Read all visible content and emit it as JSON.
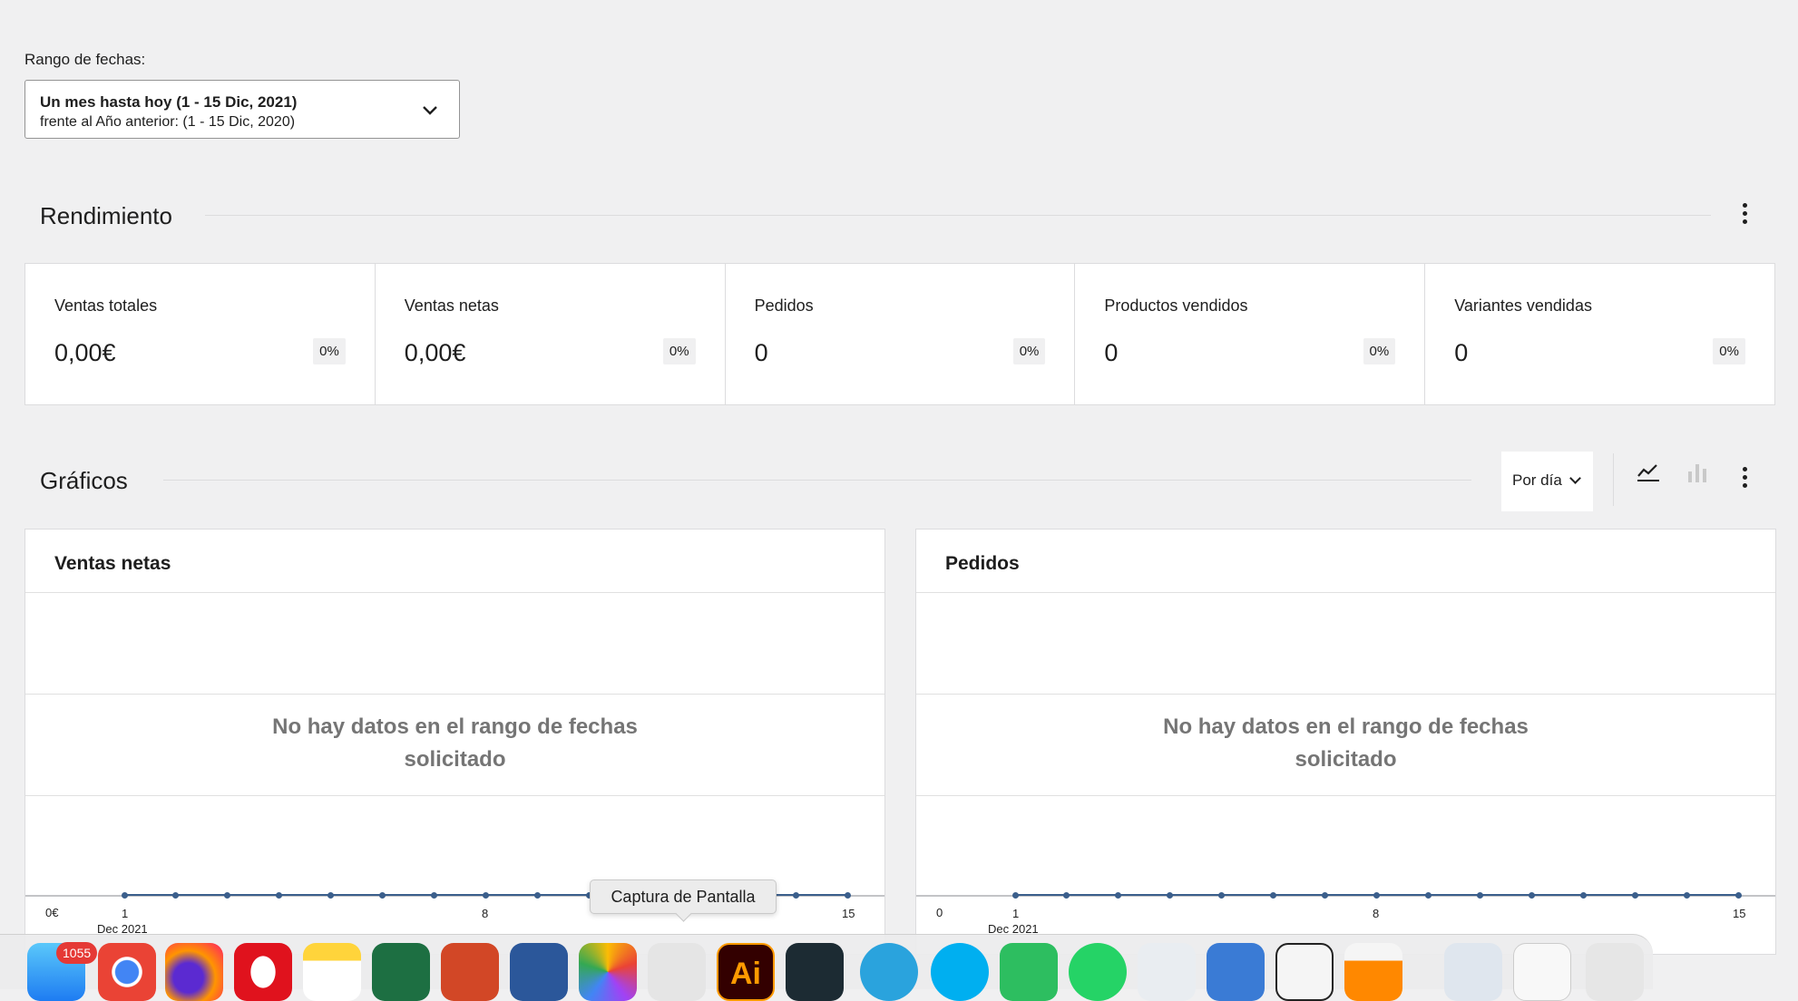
{
  "date_range": {
    "label": "Rango de fechas:",
    "primary": "Un mes hasta hoy (1 - 15 Dic, 2021)",
    "comparison": "frente al Año anterior: (1 - 15 Dic, 2020)"
  },
  "performance": {
    "title": "Rendimiento",
    "cards": [
      {
        "label": "Ventas totales",
        "value": "0,00€",
        "delta": "0%"
      },
      {
        "label": "Ventas netas",
        "value": "0,00€",
        "delta": "0%"
      },
      {
        "label": "Pedidos",
        "value": "0",
        "delta": "0%"
      },
      {
        "label": "Productos vendidos",
        "value": "0",
        "delta": "0%"
      },
      {
        "label": "Variantes vendidas",
        "value": "0",
        "delta": "0%"
      }
    ]
  },
  "charts": {
    "title": "Gráficos",
    "interval": "Por día",
    "chart_type_icons": [
      "line-chart-icon",
      "bar-chart-icon"
    ],
    "panels": [
      {
        "title": "Ventas netas",
        "empty_line1": "No hay datos en el rango de fechas",
        "empty_line2": "solicitado",
        "y_label": "0€"
      },
      {
        "title": "Pedidos",
        "empty_line1": "No hay datos en el rango de fechas",
        "empty_line2": "solicitado",
        "y_label": "0"
      }
    ],
    "x_ticks": [
      "1",
      "8",
      "15"
    ],
    "x_month": "Dec 2021"
  },
  "chart_data": [
    {
      "type": "line",
      "title": "Ventas netas",
      "x": [
        1,
        2,
        3,
        4,
        5,
        6,
        7,
        8,
        9,
        10,
        11,
        12,
        13,
        14,
        15
      ],
      "series": [
        {
          "values": [
            0,
            0,
            0,
            0,
            0,
            0,
            0,
            0,
            0,
            0,
            0,
            0,
            0,
            0,
            0
          ]
        }
      ],
      "xlabel": "Dec 2021",
      "x_tick_labels": [
        "1",
        "8",
        "15"
      ],
      "y_tick_labels": [
        "0€"
      ]
    },
    {
      "type": "line",
      "title": "Pedidos",
      "x": [
        1,
        2,
        3,
        4,
        5,
        6,
        7,
        8,
        9,
        10,
        11,
        12,
        13,
        14,
        15
      ],
      "series": [
        {
          "values": [
            0,
            0,
            0,
            0,
            0,
            0,
            0,
            0,
            0,
            0,
            0,
            0,
            0,
            0,
            0
          ]
        }
      ],
      "xlabel": "Dec 2021",
      "x_tick_labels": [
        "1",
        "8",
        "15"
      ],
      "y_tick_labels": [
        "0"
      ]
    }
  ],
  "tooltip": "Captura de Pantalla",
  "dock": {
    "mail_badge": "1055",
    "apps": [
      "mail-icon",
      "chrome-icon",
      "firefox-icon",
      "opera-icon",
      "notes-icon",
      "excel-icon",
      "powerpoint-icon",
      "word-icon",
      "photos-icon",
      "screenshot-icon",
      "illustrator-icon",
      "filmora-icon",
      "telegram-icon",
      "skype-icon",
      "evernote-icon",
      "whatsapp-icon",
      "vectorworks-icon",
      "reader-icon",
      "calculator-icon",
      "vlc-icon",
      "folder-icon",
      "document-icon",
      "trash-icon"
    ],
    "illustrator_text": "Ai"
  }
}
